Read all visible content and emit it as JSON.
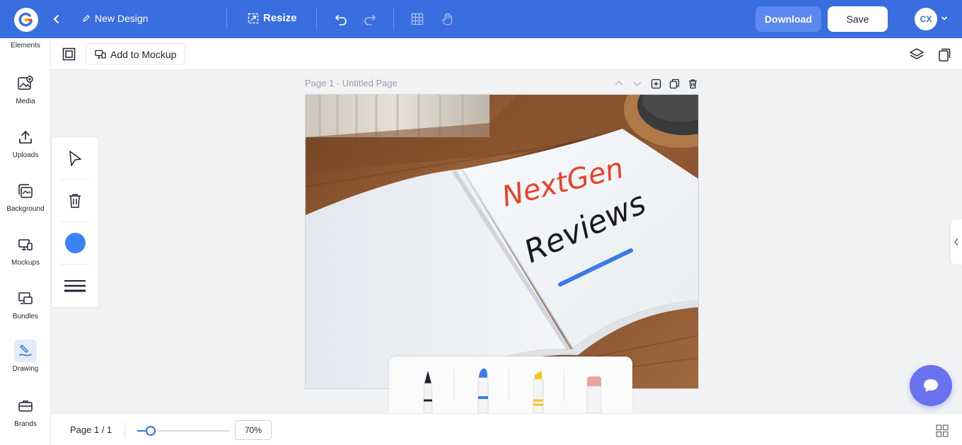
{
  "header": {
    "design_name": "New Design",
    "resize_label": "Resize",
    "download_label": "Download",
    "save_label": "Save",
    "avatar_initials": "CX",
    "brand_color": "#3a6ee0"
  },
  "sidebar": {
    "top_label": "Elements",
    "items": [
      {
        "label": "Media",
        "icon": "image-add-icon"
      },
      {
        "label": "Uploads",
        "icon": "upload-icon"
      },
      {
        "label": "Background",
        "icon": "background-icon"
      },
      {
        "label": "Mockups",
        "icon": "devices-icon"
      },
      {
        "label": "Bundles",
        "icon": "bundle-icon"
      },
      {
        "label": "Drawing",
        "icon": "drawing-icon",
        "active": true
      },
      {
        "label": "Brands",
        "icon": "briefcase-icon"
      }
    ]
  },
  "subbar": {
    "mockup_label": "Add to Mockup"
  },
  "drawtools": {
    "current_color": "#3b82f6"
  },
  "page": {
    "label": "Page 1 - Untitled Page"
  },
  "artwork": {
    "line1": "NextGen",
    "line2": "Reviews",
    "line1_color": "#e8432a",
    "line2_color": "#1a1a1a",
    "underline_color": "#3b7be8"
  },
  "bottombar": {
    "page_indicator": "Page 1 / 1",
    "zoom": "70%",
    "zoom_fraction": 0.7
  }
}
